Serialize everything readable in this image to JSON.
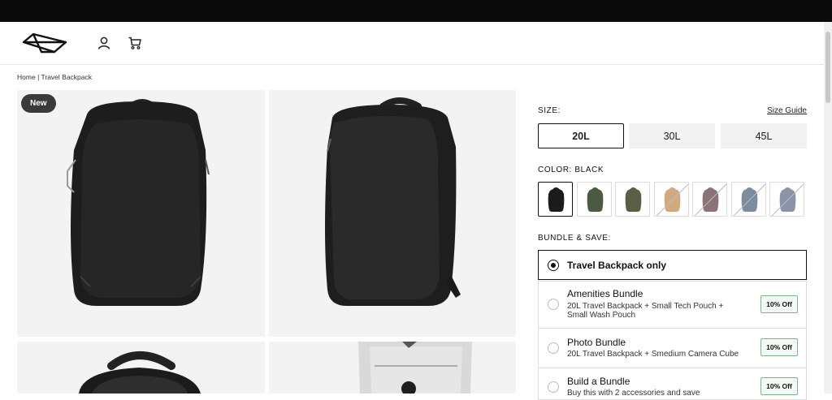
{
  "header": {
    "logo": "peak-design-logo",
    "icons": [
      "account-icon",
      "cart-icon"
    ]
  },
  "breadcrumb": {
    "home": "Home",
    "separator": "|",
    "current": "Travel Backpack"
  },
  "gallery": {
    "badge": "New"
  },
  "size": {
    "label": "SIZE:",
    "guide": "Size Guide",
    "options": [
      "20L",
      "30L",
      "45L"
    ],
    "selected": "20L"
  },
  "color": {
    "label": "COLOR: BLACK",
    "swatches": [
      {
        "name": "black",
        "hex": "#1b1b1b",
        "available": true
      },
      {
        "name": "sage",
        "hex": "#4a5a43",
        "available": true
      },
      {
        "name": "olive",
        "hex": "#5b5d45",
        "available": true
      },
      {
        "name": "tan",
        "hex": "#d3aa80",
        "available": false
      },
      {
        "name": "mauve",
        "hex": "#8c7377",
        "available": false
      },
      {
        "name": "blue-grey",
        "hex": "#7d8da1",
        "available": false
      },
      {
        "name": "slate",
        "hex": "#8a93a8",
        "available": false
      }
    ]
  },
  "bundle": {
    "label": "BUNDLE & SAVE:",
    "options": [
      {
        "title": "Travel Backpack only",
        "desc": "",
        "badge": ""
      },
      {
        "title": "Amenities Bundle",
        "desc": "20L Travel Backpack + Small Tech Pouch + Small Wash Pouch",
        "badge": "10% Off"
      },
      {
        "title": "Photo Bundle",
        "desc": "20L Travel Backpack + Smedium Camera Cube",
        "badge": "10% Off"
      },
      {
        "title": "Build a Bundle",
        "desc": "Buy this with 2 accessories and save",
        "badge": "10% Off"
      }
    ]
  },
  "colors": {
    "topbar": "#0a0a0a",
    "accent": "#111111",
    "badge_border": "#7db58b"
  }
}
